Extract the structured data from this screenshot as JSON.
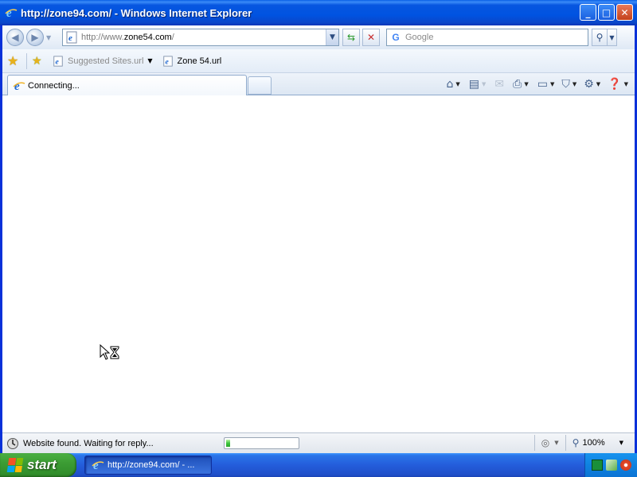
{
  "window": {
    "title": "http://zone94.com/ - Windows Internet Explorer",
    "buttons": {
      "minimize": "_",
      "maximize": "□",
      "close": "✕"
    }
  },
  "toolbar": {
    "address_prefix": "http://www.",
    "address_domain": "zone54.com",
    "address_suffix": "/",
    "search_placeholder": "Google",
    "search_logo": "G"
  },
  "favorites_bar": {
    "items": [
      {
        "label": "Suggested Sites.url",
        "has_dropdown": true,
        "muted": true
      },
      {
        "label": "Zone 54.url",
        "has_dropdown": false,
        "muted": false
      }
    ]
  },
  "tabs": {
    "active_label": "Connecting..."
  },
  "command_bar": {
    "icons": [
      "home-icon",
      "feeds-icon",
      "mail-icon",
      "print-icon",
      "page-icon",
      "safety-icon",
      "tools-icon",
      "help-icon"
    ]
  },
  "status_bar": {
    "text": "Website found. Waiting for reply...",
    "progress_fraction": 0.05,
    "zoom": "100%"
  },
  "taskbar": {
    "start_label": "start",
    "task_label": "http://zone94.com/ - ..."
  }
}
